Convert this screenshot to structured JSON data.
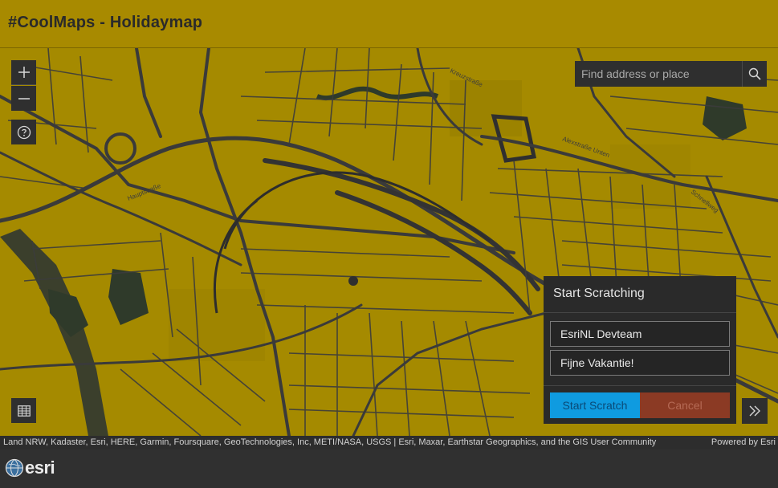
{
  "app": {
    "title": "#CoolMaps - Holidaymap"
  },
  "map_controls": {
    "zoom_in_icon": "plus-icon",
    "zoom_out_icon": "minus-icon",
    "help_icon": "question-circle-icon",
    "table_icon": "table-icon",
    "expand_icon": "double-chevron-right-icon"
  },
  "search": {
    "placeholder": "Find address or place",
    "icon": "search-icon"
  },
  "scratch_panel": {
    "title": "Start Scratching",
    "field1_value": "EsriNL Devteam",
    "field2_value": "Fijne Vakantie!",
    "start_label": "Start Scratch",
    "cancel_label": "Cancel"
  },
  "attribution": {
    "text": "Land NRW, Kadaster, Esri, HERE, Garmin, Foursquare, GeoTechnologies, Inc, METI/NASA, USGS | Esri, Maxar, Earthstar Geographics, and the GIS User Community",
    "powered_by": "Powered by Esri"
  },
  "footer": {
    "logo_text": "esri"
  },
  "colors": {
    "header": "#a88a00",
    "map_base": "#a58a00",
    "roads": "#3a3a3a",
    "panel": "#2a2a2a",
    "start_button": "#0f9be0",
    "cancel_button": "#8b3a24"
  }
}
